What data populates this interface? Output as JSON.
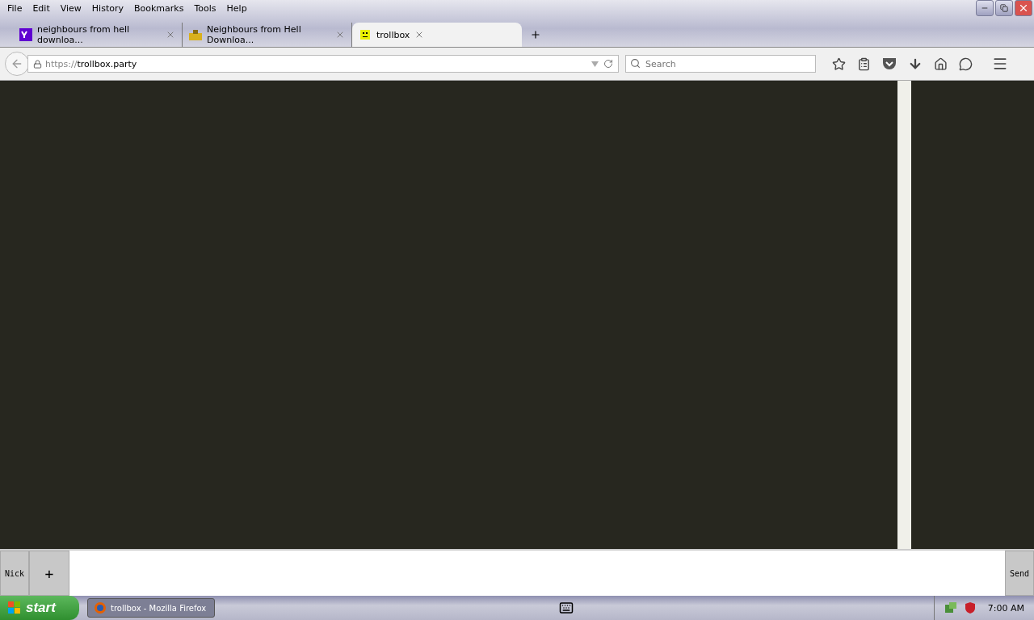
{
  "menu": [
    "File",
    "Edit",
    "View",
    "History",
    "Bookmarks",
    "Tools",
    "Help"
  ],
  "tabs": [
    {
      "title": "neighbours from hell downloa...",
      "selected": false
    },
    {
      "title": "Neighbours from Hell Downloa...",
      "selected": false
    },
    {
      "title": "trollbox",
      "selected": true
    }
  ],
  "address": {
    "scheme": "https://",
    "host": "trollbox.party"
  },
  "search": {
    "placeholder": "Search"
  },
  "chat": {
    "nick_button": "Nick",
    "add_button": "+",
    "send_button": "Send"
  },
  "taskbar": {
    "start": "start",
    "window": "trollbox - Mozilla Firefox",
    "clock": "7:00 AM"
  }
}
